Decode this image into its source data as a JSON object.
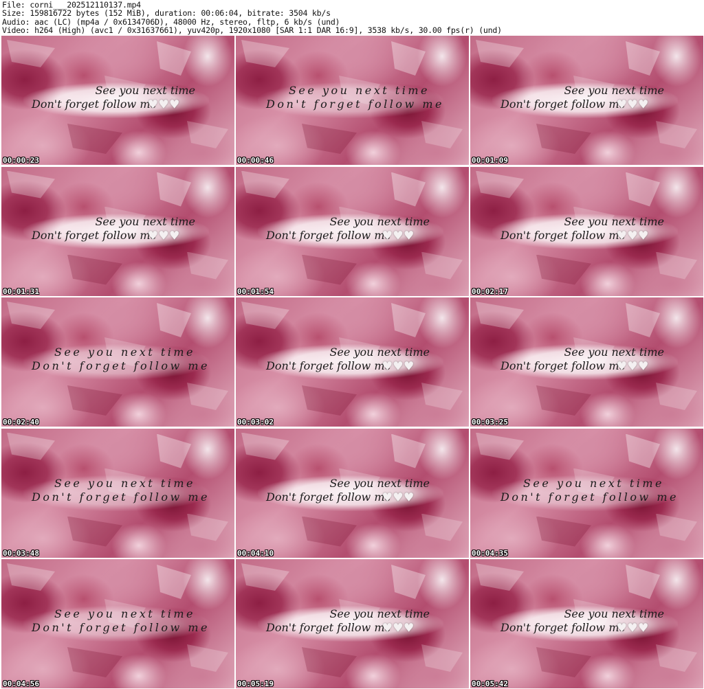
{
  "header": {
    "file_line": "File: corni___202512110137.mp4",
    "size_line": "Size: 159816722 bytes (152 MiB), duration: 00:06:04, bitrate: 3504 kb/s",
    "audio_line": "Audio: aac (LC) (mp4a / 0x6134706D), 48000 Hz, stereo, fltp, 6 kb/s (und)",
    "video_line": "Video: h264 (High) (avc1 / 0x31637661), yuv420p, 1920x1080 [SAR 1:1 DAR 16:9], 3538 kb/s, 30.00 fps(r) (und)"
  },
  "caption": {
    "line1": "See you next time",
    "line2": "Don't forget follow me",
    "heart_icon": "heart-icon",
    "heart_glyph": "♥"
  },
  "colors": {
    "background": "#ffffff",
    "timestamp_text": "#ffffff",
    "crystal_pink": "#c26b87",
    "crystal_deep": "#8e1f44"
  },
  "thumbnails": [
    {
      "timestamp": "00:00:23",
      "caption_state": "full"
    },
    {
      "timestamp": "00:00:46",
      "caption_state": "animating"
    },
    {
      "timestamp": "00:01:09",
      "caption_state": "full"
    },
    {
      "timestamp": "00:01:31",
      "caption_state": "full"
    },
    {
      "timestamp": "00:01:54",
      "caption_state": "full"
    },
    {
      "timestamp": "00:02:17",
      "caption_state": "full"
    },
    {
      "timestamp": "00:02:40",
      "caption_state": "animating"
    },
    {
      "timestamp": "00:03:02",
      "caption_state": "full"
    },
    {
      "timestamp": "00:03:25",
      "caption_state": "full"
    },
    {
      "timestamp": "00:03:48",
      "caption_state": "animating"
    },
    {
      "timestamp": "00:04:10",
      "caption_state": "full"
    },
    {
      "timestamp": "00:04:35",
      "caption_state": "animating"
    },
    {
      "timestamp": "00:04:56",
      "caption_state": "animating"
    },
    {
      "timestamp": "00:05:19",
      "caption_state": "full"
    },
    {
      "timestamp": "00:05:42",
      "caption_state": "full"
    }
  ]
}
